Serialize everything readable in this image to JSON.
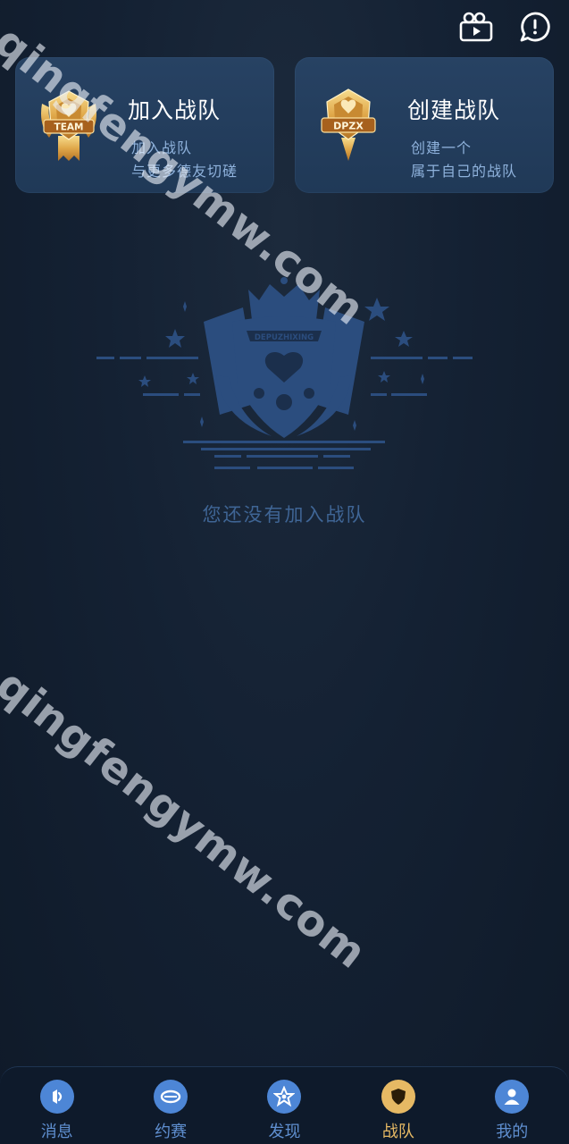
{
  "header": {
    "icons": [
      "video-camera-icon",
      "chat-bubble-icon"
    ]
  },
  "cards": [
    {
      "title": "加入战队",
      "badge_text": "TEAM",
      "sub_line1": "加入战队",
      "sub_line2": "与更多德友切磋"
    },
    {
      "title": "创建战队",
      "badge_text": "DPZX",
      "sub_line1": "创建一个",
      "sub_line2": "属于自己的战队"
    }
  ],
  "emblem": {
    "text": "DEPUZHIXING"
  },
  "empty_state": {
    "text": "您还没有加入战队"
  },
  "watermark": {
    "text": "qingfengymw.com"
  },
  "tabs": [
    {
      "label": "消息",
      "icon": "message-icon",
      "active": false
    },
    {
      "label": "约赛",
      "icon": "match-icon",
      "active": false
    },
    {
      "label": "发现",
      "icon": "discover-icon",
      "active": false
    },
    {
      "label": "战队",
      "icon": "team-icon",
      "active": true
    },
    {
      "label": "我的",
      "icon": "profile-icon",
      "active": false
    }
  ],
  "colors": {
    "accent_gold": "#e6b964",
    "tab_blue": "#5f8fd0",
    "card_bg": "#24405f",
    "muted_text": "#3f6595"
  }
}
